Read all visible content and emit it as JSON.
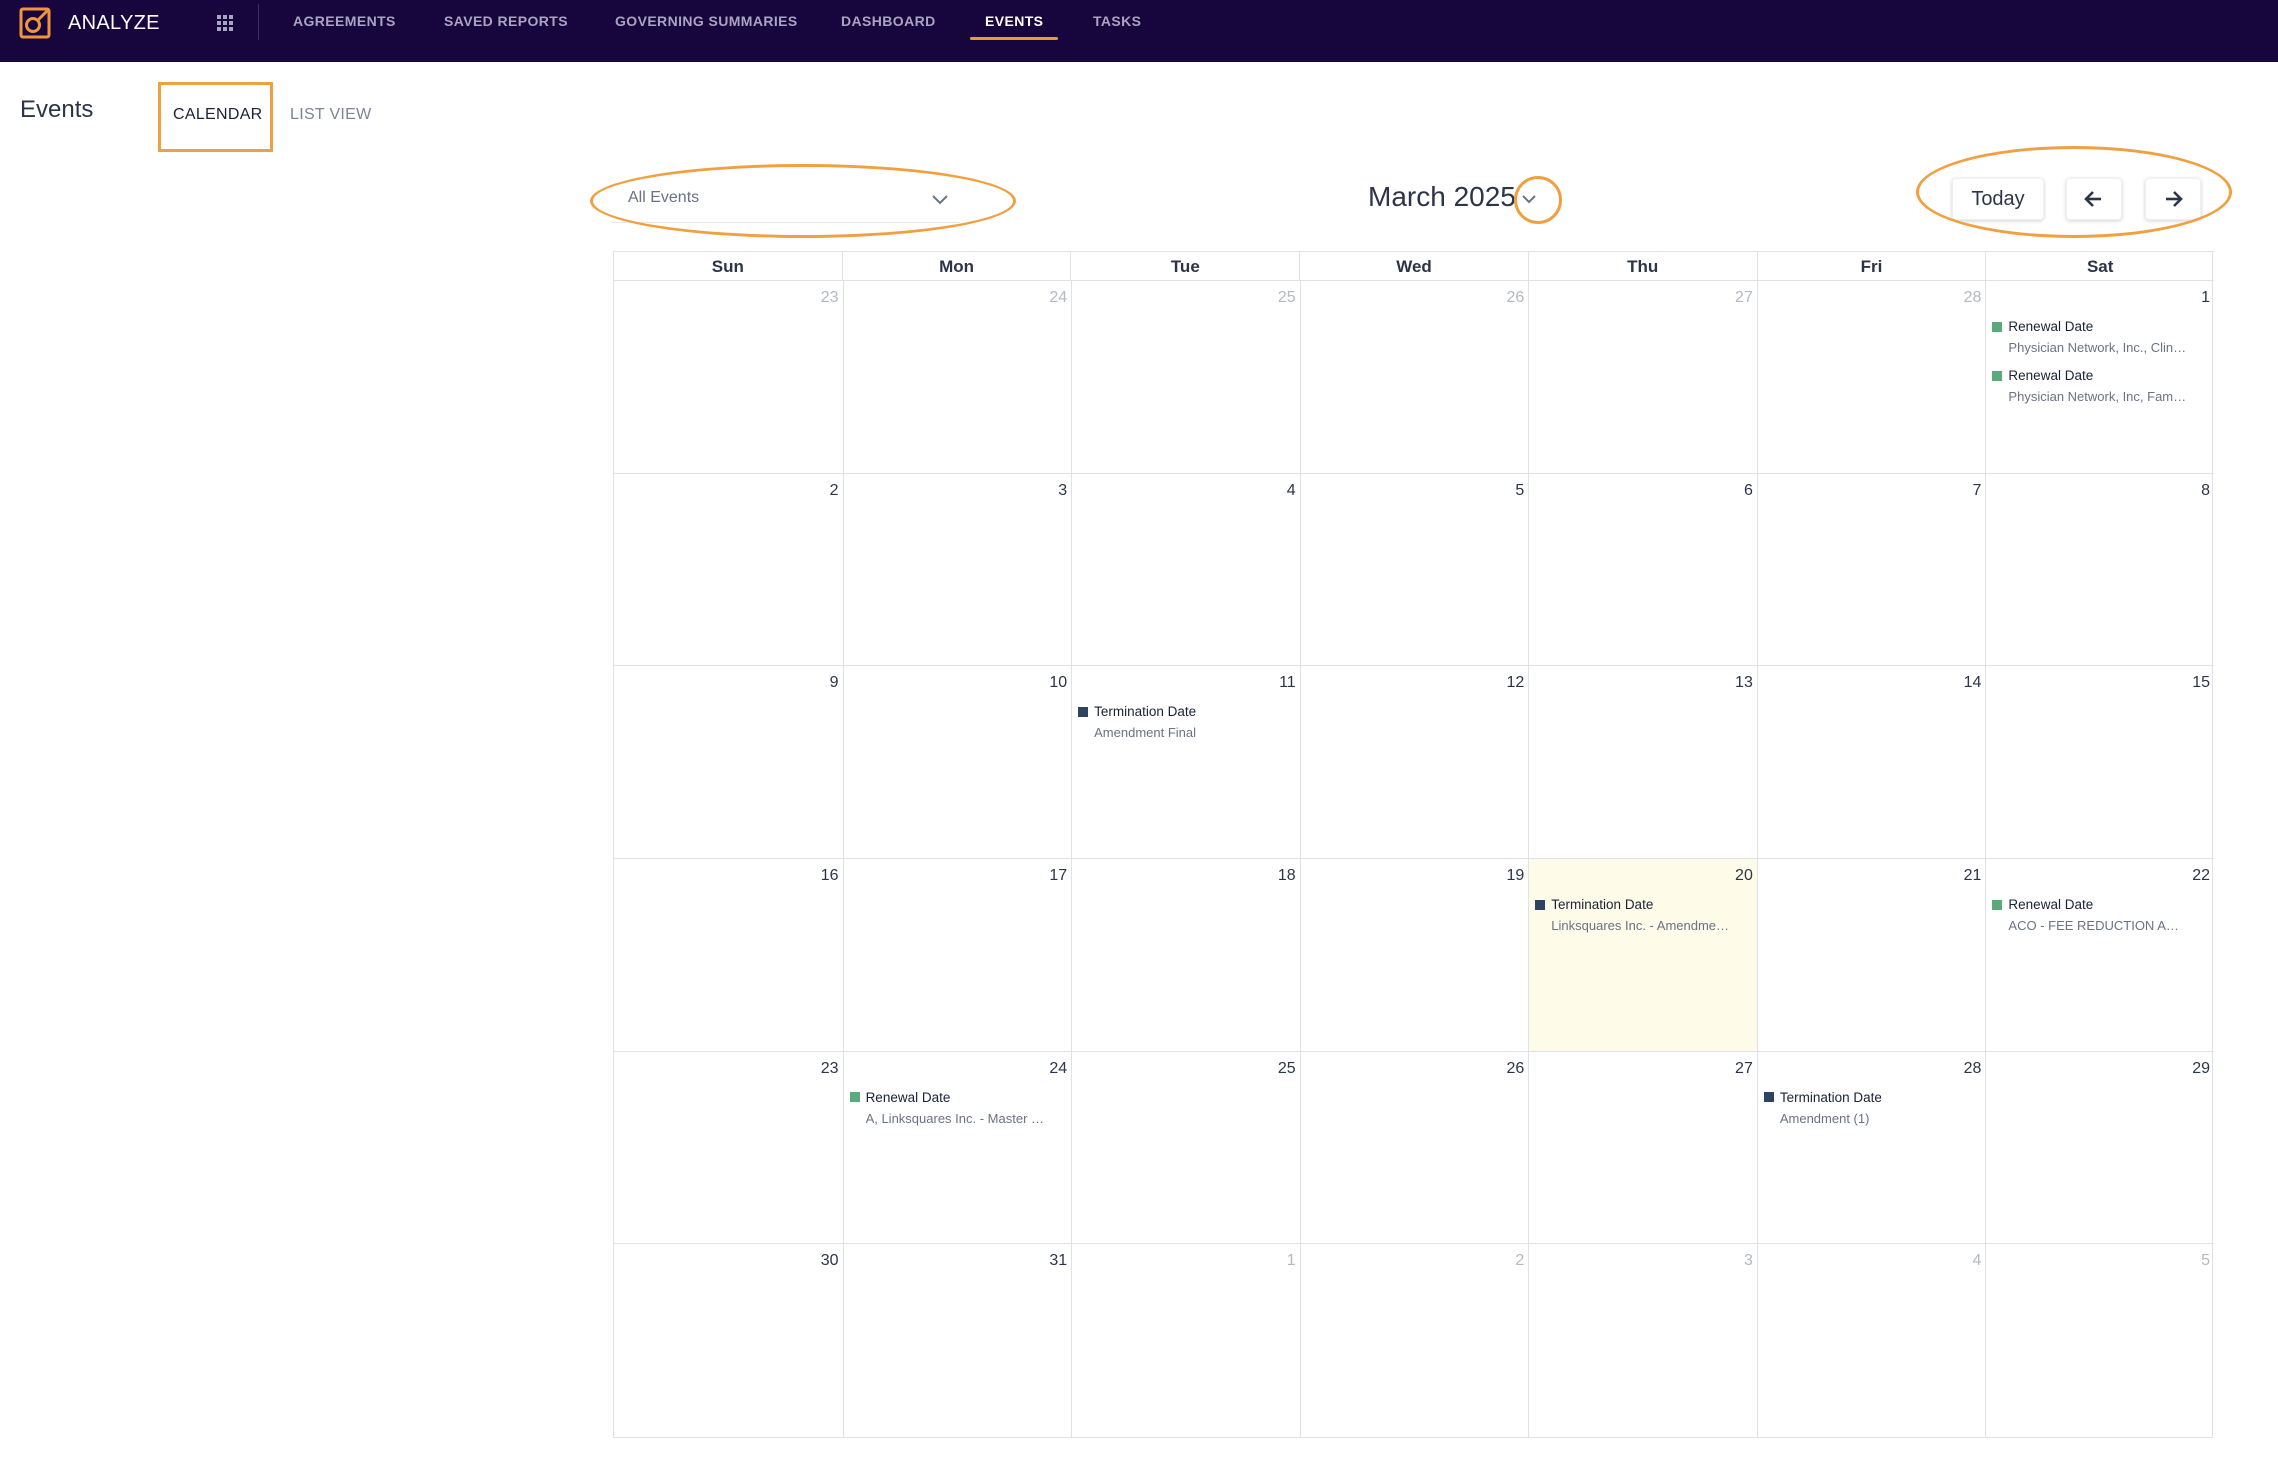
{
  "app": {
    "name": "ANALYZE"
  },
  "nav": {
    "items": [
      {
        "label": "AGREEMENTS",
        "active": false
      },
      {
        "label": "SAVED REPORTS",
        "active": false
      },
      {
        "label": "GOVERNING SUMMARIES",
        "active": false
      },
      {
        "label": "DASHBOARD",
        "active": false
      },
      {
        "label": "EVENTS",
        "active": true
      },
      {
        "label": "TASKS",
        "active": false
      }
    ]
  },
  "page": {
    "title": "Events",
    "tabs": [
      {
        "label": "CALENDAR",
        "active": true
      },
      {
        "label": "LIST VIEW",
        "active": false
      }
    ]
  },
  "toolbar": {
    "filter_value": "All Events",
    "month_label": "March 2025",
    "today_label": "Today"
  },
  "calendar": {
    "weekdays": [
      "Sun",
      "Mon",
      "Tue",
      "Wed",
      "Thu",
      "Fri",
      "Sat"
    ],
    "days": [
      {
        "num": "23",
        "other": true
      },
      {
        "num": "24",
        "other": true
      },
      {
        "num": "25",
        "other": true
      },
      {
        "num": "26",
        "other": true
      },
      {
        "num": "27",
        "other": true
      },
      {
        "num": "28",
        "other": true
      },
      {
        "num": "1",
        "other": false,
        "events": [
          {
            "title": "Renewal Date",
            "sub": "Physician Network, Inc., Clin…",
            "kind": "renewal"
          },
          {
            "title": "Renewal Date",
            "sub": "Physician Network, Inc, Fam…",
            "kind": "renewal"
          }
        ]
      },
      {
        "num": "2"
      },
      {
        "num": "3"
      },
      {
        "num": "4"
      },
      {
        "num": "5"
      },
      {
        "num": "6"
      },
      {
        "num": "7"
      },
      {
        "num": "8"
      },
      {
        "num": "9"
      },
      {
        "num": "10"
      },
      {
        "num": "11",
        "events": [
          {
            "title": "Termination Date",
            "sub": "Amendment Final",
            "kind": "termination"
          }
        ]
      },
      {
        "num": "12"
      },
      {
        "num": "13"
      },
      {
        "num": "14"
      },
      {
        "num": "15"
      },
      {
        "num": "16"
      },
      {
        "num": "17"
      },
      {
        "num": "18"
      },
      {
        "num": "19"
      },
      {
        "num": "20",
        "today": true,
        "events": [
          {
            "title": "Termination Date",
            "sub": "Linksquares Inc. - Amendme…",
            "kind": "termination"
          }
        ]
      },
      {
        "num": "21"
      },
      {
        "num": "22",
        "events": [
          {
            "title": "Renewal Date",
            "sub": "ACO - FEE REDUCTION A…",
            "kind": "renewal"
          }
        ]
      },
      {
        "num": "23"
      },
      {
        "num": "24",
        "events": [
          {
            "title": "Renewal Date",
            "sub": "A, Linksquares Inc. - Master …",
            "kind": "renewal"
          }
        ]
      },
      {
        "num": "25"
      },
      {
        "num": "26"
      },
      {
        "num": "27"
      },
      {
        "num": "28",
        "events": [
          {
            "title": "Termination Date",
            "sub": "Amendment (1)",
            "kind": "termination"
          }
        ]
      },
      {
        "num": "29"
      },
      {
        "num": "30"
      },
      {
        "num": "31"
      },
      {
        "num": "1",
        "other": true
      },
      {
        "num": "2",
        "other": true
      },
      {
        "num": "3",
        "other": true
      },
      {
        "num": "4",
        "other": true
      },
      {
        "num": "5",
        "other": true
      }
    ]
  },
  "colors": {
    "nav_bg": "#16063d",
    "accent": "#f0953a",
    "renewal": "#5aab7b",
    "termination": "#2e4361",
    "today_bg": "#fefbe8"
  },
  "icons": {
    "logo": "analyze-logo-icon",
    "apps": "grid-apps-icon",
    "filter_chevron": "chevron-down-icon",
    "month_chevron": "chevron-down-icon",
    "prev": "arrow-left-icon",
    "next": "arrow-right-icon"
  }
}
